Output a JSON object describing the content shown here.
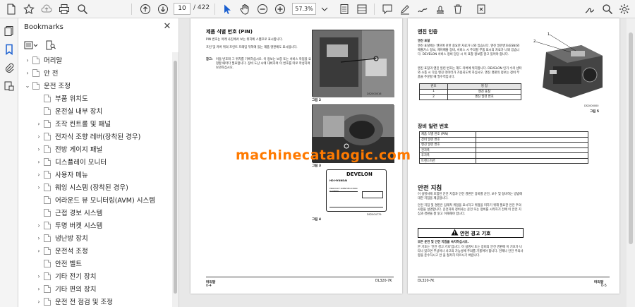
{
  "toolbar": {
    "page_current": "10",
    "page_total": "/ 422",
    "zoom": "57.3%"
  },
  "bookmarks": {
    "title": "Bookmarks",
    "items": [
      {
        "label": "머리말",
        "level": 1,
        "expander": "›"
      },
      {
        "label": "안 전",
        "level": 1,
        "expander": "›"
      },
      {
        "label": "운전 조정",
        "level": 1,
        "expander": "⌄"
      },
      {
        "label": "부품 위치도",
        "level": 2,
        "expander": ""
      },
      {
        "label": "운전실 내부 장치",
        "level": 2,
        "expander": ""
      },
      {
        "label": "조작 컨트롤 및 패널",
        "level": 2,
        "expander": "›"
      },
      {
        "label": "전자식 조향 레버(장착된 경우)",
        "level": 2,
        "expander": "›"
      },
      {
        "label": "전방 게이지 패널",
        "level": 2,
        "expander": "›"
      },
      {
        "label": "디스플레이 모니터",
        "level": 2,
        "expander": "›"
      },
      {
        "label": "사용자 메뉴",
        "level": 2,
        "expander": "›"
      },
      {
        "label": "웨잉 시스템 (장착된 경우)",
        "level": 2,
        "expander": "›"
      },
      {
        "label": "어라운드 뷰 모니터링(AVM) 시스템",
        "level": 2,
        "expander": ""
      },
      {
        "label": "근접 경보 시스템",
        "level": 2,
        "expander": ""
      },
      {
        "label": "투명 버켓 시스템",
        "level": 2,
        "expander": "›"
      },
      {
        "label": "냉난방 장치",
        "level": 2,
        "expander": "›"
      },
      {
        "label": "운전석 조정",
        "level": 2,
        "expander": "›"
      },
      {
        "label": "안전 벨트",
        "level": 2,
        "expander": ""
      },
      {
        "label": "기타 전기 장치",
        "level": 2,
        "expander": "›"
      },
      {
        "label": "기타 편의 장치",
        "level": 2,
        "expander": "›"
      },
      {
        "label": "운전 전 점검 및 조정",
        "level": 2,
        "expander": "›"
      }
    ]
  },
  "left_page": {
    "heading": "제품 식별 번호 (PIN)",
    "para1": "PIN 번호는 아래 사진에서 보는 위치에 스탬프로 표시합니다.",
    "para2": "프린 및 커버 위의 프린트 프레임 뒤쪽에 있는 제품 명판에도 표시됩니다.",
    "note_label": "참고:",
    "note_text": "이들 번호와 그 위치를 기록하십시오. 이 정보는 보증 또는 서비스 작업을 요청할 때마다 필요합니다. 장비 도난 시에 대비하여 이 번호를 따로 작성하여 보관하십시오.",
    "fig2": "그림 2",
    "fig3": "그림 3",
    "fig4": "그림 4",
    "fig2_code": "DS2000016",
    "fig4_code": "DS2004779",
    "plate_brand": "DEVELON",
    "plate_brand2": "HD HYUNDAI",
    "plate_title": "PRODUCT IDENTIFICATION NUMBER",
    "footer_left": "머리말",
    "footer_page": "0-4",
    "footer_right": "DL320-7K"
  },
  "right_page": {
    "heading": "엔진 인증",
    "sub": "엔진 표찰",
    "para1": "엔진 표찰에는 엔진에 관한 중요한 자료가 나와 있습니다. 엔진 일련번호(ESN)와 배출가스 정보, 제어배출 장비, 서비스 시 주의할 부품 표시의 자료가 나와 있습니다. DEVELON 서비스 정비 담당 시 이 표찰 정보를 알고 있어야 합니다.",
    "para2": "엔진 표찰과 엔진 일련 번호는 헤드 커버에 위치합니다. DEVELON 인가 수리 센터와 소통 시 다음 엔진 데이터가 가용되도록 하십시오. 엔진 명판의 정보는 정비 부품을 주문할 때 필수적입니다.",
    "engine_table_headers": [
      "번호",
      "명 칭"
    ],
    "engine_table_rows": [
      [
        "1",
        "엔진 표찰"
      ],
      [
        "2",
        "엔진 일련 번호"
      ]
    ],
    "fig5": "그림 5",
    "fig5_code": "DS2000000",
    "callout1": "1",
    "callout2": "2",
    "serial_heading": "장비 일련 번호",
    "serial_rows": [
      "제품 식별 번호 (PIN)",
      "장비 일련 번호",
      "엔진 일련 번호",
      "전자폭",
      "후자폭",
      "트랜스미션"
    ],
    "safety_heading": "안전 지침",
    "safety_para1": "이 설명서에 포함된 안전 지침과 안전 경판은 장비를 운전, 보수 및 정비하는 방법에 대한 지침을 제공합니다.",
    "safety_para2": "안전 지침 및 경판은 잠재적 위험을 표시하고 위험을 피하기 위해 필요한 안전 주의사항을 설명합니다. 운전자와 정비사는 운전 또는 정비를 시작하기 전에 이 안전 지침과 경판을 잘 읽고 이해해야 합니다.",
    "warn_title": "안전 경고 기호",
    "warn_text1": "모든 운전 및 안전 지침을 숙지하십시오.",
    "warn_text2": "본 기호는 '안전 경고 기호'입니다. 이 설명서 또는 장비의 안전 경판에 이 기호가 나타나 있으면 부상이나 사고의 가능성에 주의를 기울여야 합니다. 언제나 안전 주의사항을 준수하시고 안 을 철저히 따르시기 바랍니다.",
    "footer_left": "DL320-7K",
    "footer_right": "머리말",
    "footer_page": "0-5"
  },
  "watermark": "machinecatalogic.com",
  "colors": {
    "accent": "#1a73e8",
    "watermark": "#ff7a00",
    "warning_box": "#ffffff"
  }
}
